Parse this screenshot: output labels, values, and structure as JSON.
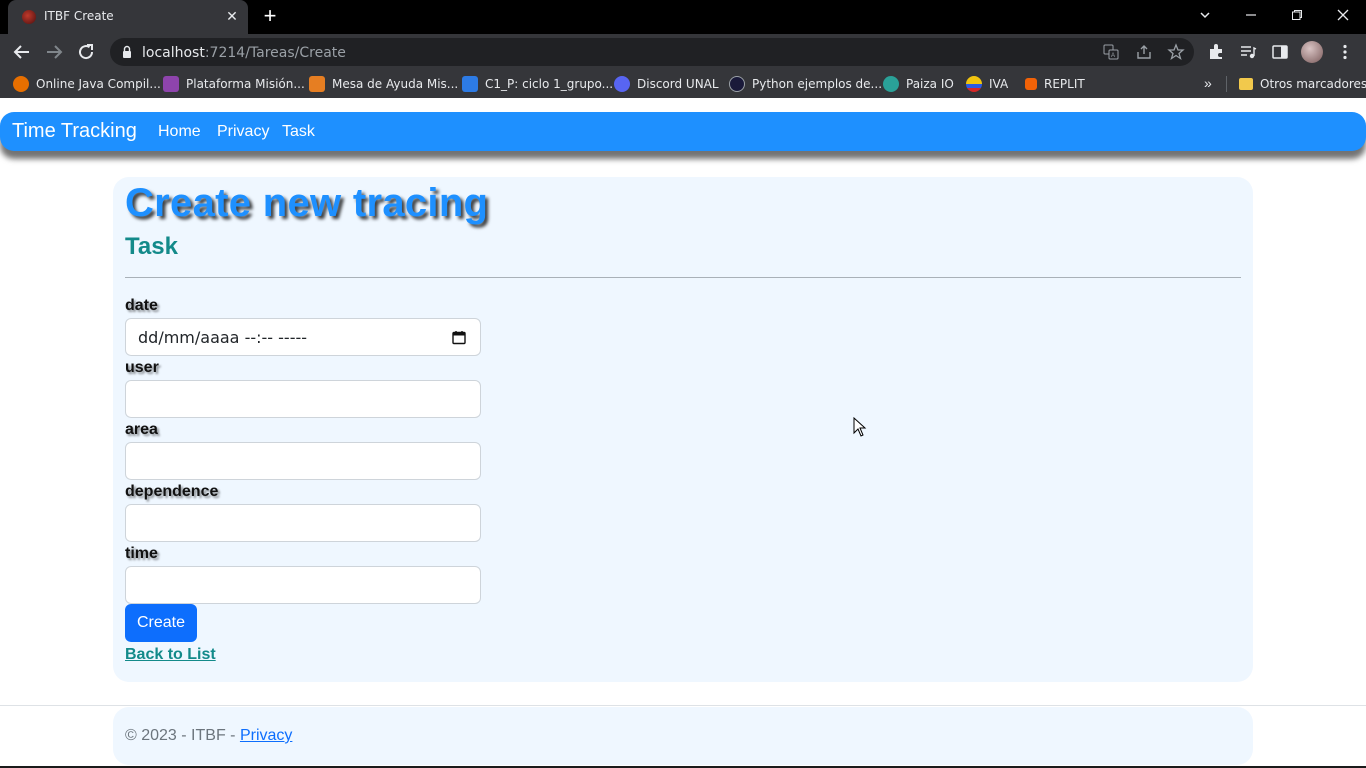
{
  "browser": {
    "tab": {
      "title": "ITBF Create"
    },
    "address": {
      "host": "localhost",
      "path": ":7214/Tareas/Create"
    },
    "bookmarks": [
      {
        "label": "Online Java Compil...",
        "icon": "java-icon",
        "color": "#e76f00"
      },
      {
        "label": "Plataforma Misión...",
        "icon": "platform-icon",
        "color": "#8e44ad"
      },
      {
        "label": "Mesa de Ayuda Mis...",
        "icon": "helpdesk-icon",
        "color": "#e67e22"
      },
      {
        "label": "C1_P: ciclo 1_grupo...",
        "icon": "mintic-icon",
        "color": "#2d7be5"
      },
      {
        "label": "Discord UNAL",
        "icon": "discord-icon",
        "color": "#5865f2"
      },
      {
        "label": "Python ejemplos de...",
        "icon": "python-icon",
        "color": "#1a1a3a"
      },
      {
        "label": "Paiza IO",
        "icon": "paiza-icon",
        "color": "#2aa198"
      },
      {
        "label": "IVA",
        "icon": "iva-icon",
        "color": "#f1c40f"
      },
      {
        "label": "REPLIT",
        "icon": "replit-icon",
        "color": "#f26207"
      }
    ],
    "other_bookmarks": "Otros marcadores"
  },
  "app": {
    "brand": "Time Tracking",
    "nav": [
      {
        "label": "Home"
      },
      {
        "label": "Privacy"
      },
      {
        "label": "Task"
      }
    ],
    "accent_color": "#1e90ff"
  },
  "form": {
    "title": "Create new tracing",
    "subtitle": "Task",
    "fields": [
      {
        "label": "date",
        "value": "dd/mm/aaaa --:--  -----"
      },
      {
        "label": "user",
        "value": ""
      },
      {
        "label": "area",
        "value": ""
      },
      {
        "label": "dependence",
        "value": ""
      },
      {
        "label": "time",
        "value": ""
      }
    ],
    "submit_label": "Create",
    "back_link": "Back to List"
  },
  "footer": {
    "text": "© 2023 - ITBF - ",
    "link": "Privacy"
  }
}
